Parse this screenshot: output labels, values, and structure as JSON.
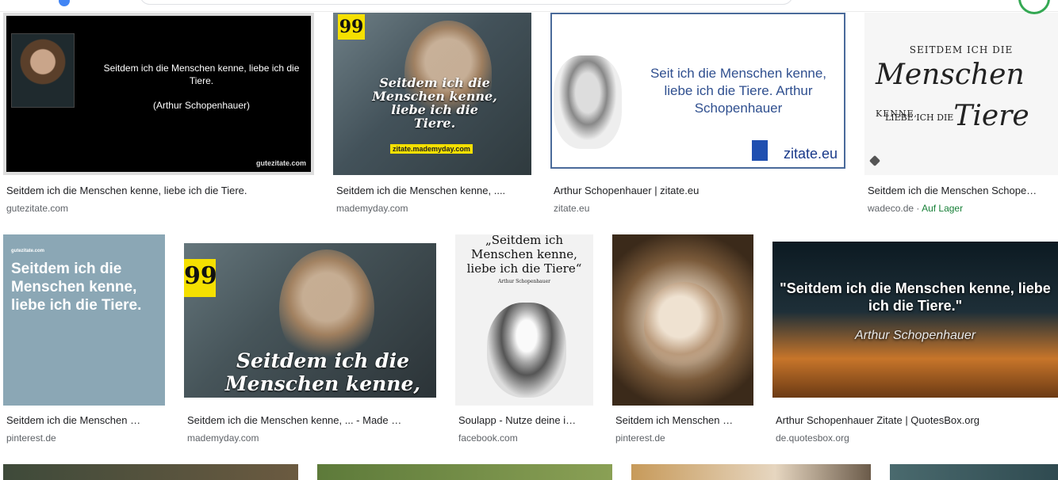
{
  "results_row1": [
    {
      "title": "Seitdem ich die Menschen kenne, liebe ich die Tiere.",
      "source": "gutezitate.com",
      "image_text": {
        "quote": "Seitdem ich die Menschen kenne, liebe ich die Tiere.",
        "author": "(Arthur Schopenhauer)",
        "watermark": "gutezitate.com"
      }
    },
    {
      "title": "Seitdem ich die Menschen kenne, ....",
      "source": "mademyday.com",
      "image_text": {
        "badge": "99",
        "quote": "Seitdem ich die Menschen kenne, liebe ich die Tiere.",
        "tag": "zitate.mademyday.com"
      }
    },
    {
      "title": "Arthur Schopenhauer | zitate.eu",
      "source": "zitate.eu",
      "image_text": {
        "quote": "Seit ich die Menschen kenne, liebe ich die Tiere.  Arthur Schopenhauer",
        "logo": "zitate.eu"
      }
    },
    {
      "title": "Seitdem ich die Menschen Schope…",
      "source": "wadeco.de",
      "source_extra": "Auf Lager",
      "image_text": {
        "line1": "SEITDEM ICH DIE",
        "line2a": "Menschen",
        "line2b": "KENNE,",
        "line3a": "LIEBE ICH DIE",
        "line3b": "Tiere"
      }
    }
  ],
  "results_row2": [
    {
      "title": "Seitdem ich die Menschen …",
      "source": "pinterest.de",
      "image_text": {
        "small": "gutezitate.com",
        "quote": "Seitdem ich die Menschen kenne, liebe ich die Tiere."
      }
    },
    {
      "title": "Seitdem ich die Menschen kenne, ... - Made …",
      "source": "mademyday.com",
      "image_text": {
        "badge": "99",
        "quote": "Seitdem ich die Menschen kenne,"
      }
    },
    {
      "title": "Soulapp - Nutze deine i…",
      "source": "facebook.com",
      "image_text": {
        "quote": "„Seitdem ich Menschen kenne, liebe ich die Tiere“",
        "author": "Arthur Schopenhauer"
      }
    },
    {
      "title": "Seitdem ich Menschen …",
      "source": "pinterest.de"
    },
    {
      "title": "Arthur Schopenhauer Zitate | QuotesBox.org",
      "source": "de.quotesbox.org",
      "image_text": {
        "quote": "\"Seitdem ich die Menschen kenne, liebe ich die Tiere.\"",
        "author": "Arthur Schopenhauer"
      }
    }
  ]
}
